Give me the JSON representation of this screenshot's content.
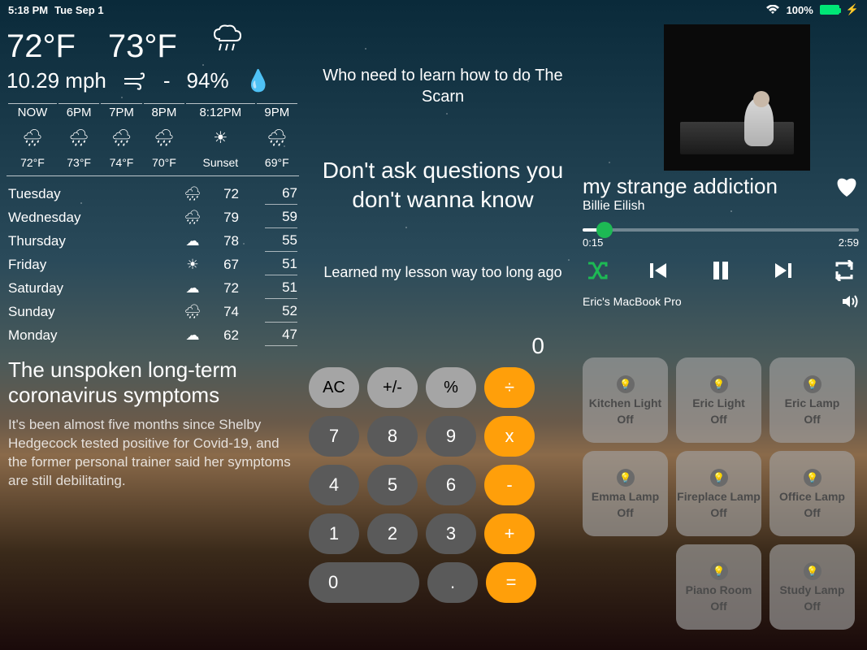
{
  "status": {
    "time": "5:18 PM",
    "date": "Tue Sep 1",
    "battery": "100%"
  },
  "weather": {
    "current_temp": "72°F",
    "feels_like": "73°F",
    "wind": "10.29 mph",
    "humidity": "94%",
    "hourly": [
      {
        "time": "NOW",
        "icon": "🌧",
        "temp": "72°F"
      },
      {
        "time": "6PM",
        "icon": "🌧",
        "temp": "73°F"
      },
      {
        "time": "7PM",
        "icon": "🌧",
        "temp": "74°F"
      },
      {
        "time": "8PM",
        "icon": "🌧",
        "temp": "70°F"
      },
      {
        "time": "8:12PM",
        "icon": "☀",
        "temp": "Sunset"
      },
      {
        "time": "9PM",
        "icon": "🌧",
        "temp": "69°F"
      }
    ],
    "daily": [
      {
        "day": "Tuesday",
        "icon": "🌧",
        "hi": "72",
        "lo": "67"
      },
      {
        "day": "Wednesday",
        "icon": "🌧",
        "hi": "79",
        "lo": "59"
      },
      {
        "day": "Thursday",
        "icon": "☁",
        "hi": "78",
        "lo": "55"
      },
      {
        "day": "Friday",
        "icon": "☀",
        "hi": "67",
        "lo": "51"
      },
      {
        "day": "Saturday",
        "icon": "☁",
        "hi": "72",
        "lo": "51"
      },
      {
        "day": "Sunday",
        "icon": "🌧",
        "hi": "74",
        "lo": "52"
      },
      {
        "day": "Monday",
        "icon": "☁",
        "hi": "62",
        "lo": "47"
      }
    ]
  },
  "lyrics": {
    "line1": "Who need to learn how to do The Scarn",
    "line2": "Don't ask questions you don't wanna know",
    "line3": "Learned my lesson way too long ago"
  },
  "music": {
    "track": "my strange addiction",
    "artist": "Billie Eilish",
    "elapsed": "0:15",
    "duration": "2:59",
    "device": "Eric's MacBook Pro"
  },
  "news": {
    "headline": "The unspoken long-term coronavirus symptoms",
    "body": "It's been almost five months since Shelby Hedgecock tested positive for Covid-19, and the former personal trainer said her symptoms are still debilitating."
  },
  "calc": {
    "display": "0",
    "ac": "AC",
    "plusminus": "+/-",
    "percent": "%",
    "div": "÷",
    "n7": "7",
    "n8": "8",
    "n9": "9",
    "mul": "x",
    "n4": "4",
    "n5": "5",
    "n6": "6",
    "sub": "-",
    "n1": "1",
    "n2": "2",
    "n3": "3",
    "add": "+",
    "n0": "0",
    "dot": ".",
    "eq": "="
  },
  "home": {
    "tiles": [
      {
        "name": "Kitchen Light",
        "state": "Off"
      },
      {
        "name": "Eric Light",
        "state": "Off"
      },
      {
        "name": "Eric Lamp",
        "state": "Off"
      },
      {
        "name": "Emma Lamp",
        "state": "Off"
      },
      {
        "name": "Fireplace Lamp",
        "state": "Off"
      },
      {
        "name": "Office Lamp",
        "state": "Off"
      },
      {
        "name": "Piano Room",
        "state": "Off"
      },
      {
        "name": "Study Lamp",
        "state": "Off"
      }
    ]
  }
}
